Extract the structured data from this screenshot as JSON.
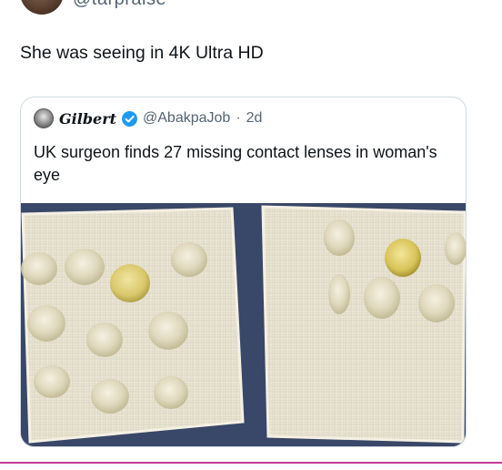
{
  "tweet": {
    "handle_partial": "@tarpraise",
    "text": "She was seeing in 4K Ultra HD"
  },
  "quoted_tweet": {
    "display_name": "Gilbert",
    "verified": true,
    "handle": "@AbakpaJob",
    "separator": "·",
    "time": "2d",
    "text": "UK surgeon finds 27 missing contact lenses in woman's eye"
  },
  "colors": {
    "text_primary": "#0f1419",
    "text_secondary": "#536471",
    "verified_blue": "#1d9bf0",
    "card_border": "#cfd9de",
    "separator": "#c63a9c"
  },
  "icons": [
    "avatar",
    "verified-badge-icon"
  ]
}
